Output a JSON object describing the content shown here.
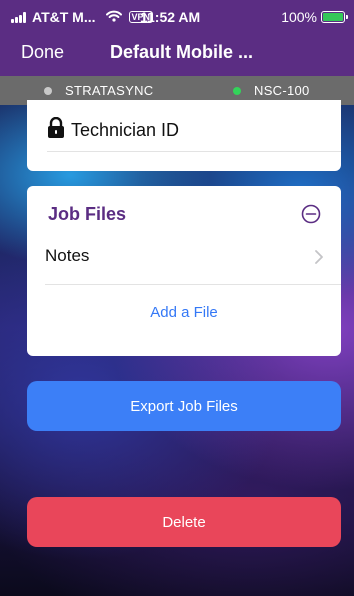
{
  "status_bar": {
    "carrier": "AT&T M...",
    "vpn": "VPN",
    "time": "11:52 AM",
    "battery": "100%",
    "battery_color": "#35c759"
  },
  "nav": {
    "done_label": "Done",
    "title": "Default Mobile ...",
    "bar_color": "#5b2d83"
  },
  "devices": [
    {
      "name": "STRATASYNC",
      "status_color": "#c9c9c9"
    },
    {
      "name": "NSC-100",
      "status_color": "#33d35a"
    }
  ],
  "technician_card": {
    "label": "Technician ID",
    "icon": "lock-icon"
  },
  "job_files": {
    "title": "Job Files",
    "collapse_icon": "minus-circle-icon",
    "items": [
      {
        "label": "Notes",
        "icon": "chevron-right-icon"
      }
    ],
    "add_label": "Add a File"
  },
  "buttons": {
    "export_label": "Export Job Files",
    "export_color": "#3c7ff7",
    "delete_label": "Delete",
    "delete_color": "#e9465a"
  }
}
